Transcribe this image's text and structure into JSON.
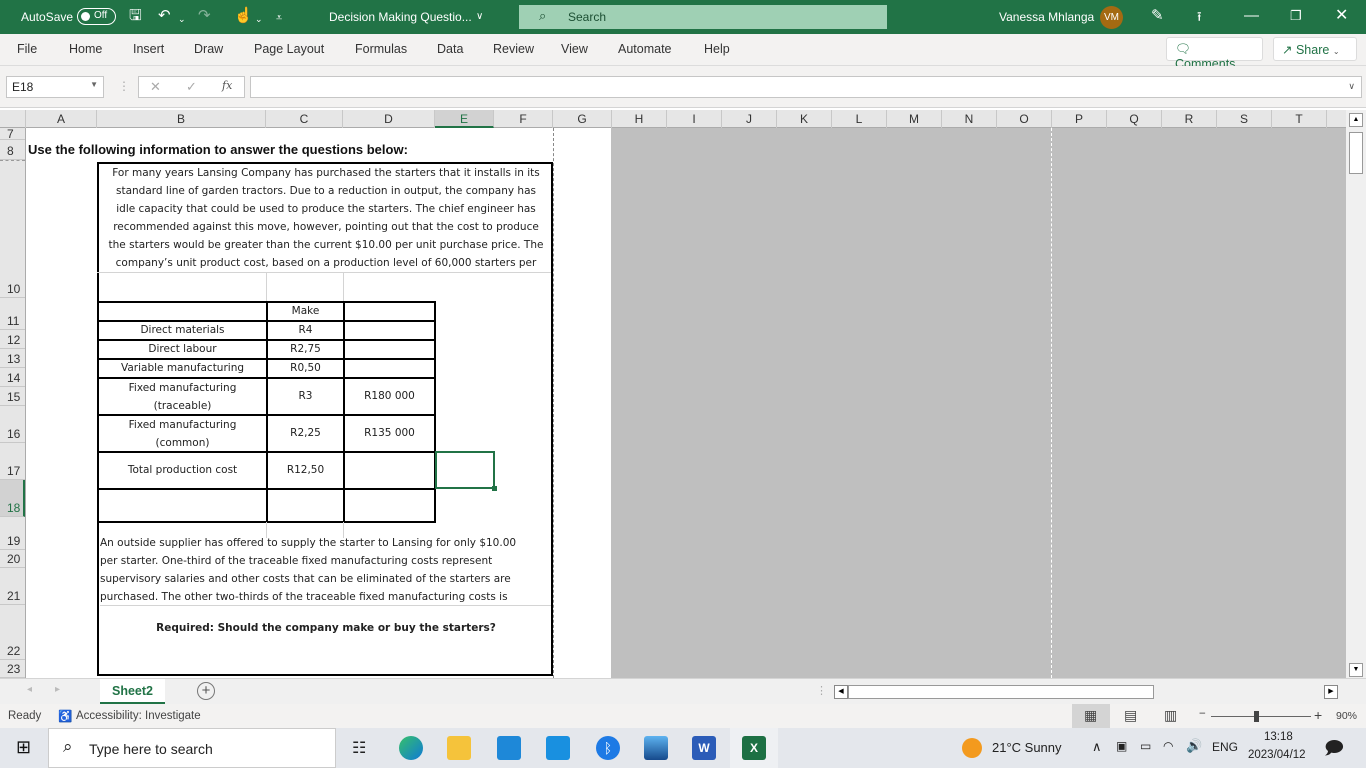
{
  "titlebar": {
    "autosave_label": "AutoSave",
    "autosave_state": "Off",
    "document_title": "Decision Making Questio...",
    "search_placeholder": "Search",
    "user_name": "Vanessa Mhlanga",
    "user_initials": "VM"
  },
  "ribbon": {
    "tabs": [
      "File",
      "Home",
      "Insert",
      "Draw",
      "Page Layout",
      "Formulas",
      "Data",
      "Review",
      "View",
      "Automate",
      "Help"
    ],
    "comments_label": "Comments",
    "share_label": "Share"
  },
  "formula_bar": {
    "name_box": "E18",
    "formula": "",
    "fx_label": "fx"
  },
  "grid": {
    "columns": [
      "A",
      "B",
      "C",
      "D",
      "E",
      "F",
      "G",
      "H",
      "I",
      "J",
      "K",
      "L",
      "M",
      "N",
      "O",
      "P",
      "Q",
      "R",
      "S",
      "T"
    ],
    "selected_column": "E",
    "rows": [
      "7",
      "8",
      "10",
      "11",
      "12",
      "13",
      "14",
      "15",
      "16",
      "17",
      "18",
      "19",
      "20",
      "21",
      "22",
      "23"
    ],
    "selected_row": "18",
    "selected_cell": "E18"
  },
  "sheet": {
    "heading": "Use the following information to answer the questions below:",
    "intro_lines": [
      "For many years Lansing Company has purchased the starters that it installs in its",
      "standard line of garden tractors. Due to a reduction in output, the company has",
      "idle capacity that could be used to produce the starters. The chief engineer has",
      "recommended against this move, however, pointing out that the cost to produce",
      "the starters would be greater than the current $10.00 per unit purchase price. The",
      "company’s unit product cost, based on a production level of 60,000 starters per"
    ],
    "table": {
      "header": [
        "",
        "Make",
        ""
      ],
      "rows": [
        {
          "label": "Direct materials",
          "make": "R4",
          "total": ""
        },
        {
          "label": "Direct labour",
          "make": "R2,75",
          "total": ""
        },
        {
          "label": "Variable manufacturing",
          "make": "R0,50",
          "total": ""
        },
        {
          "label": "Fixed manufacturing (traceable)",
          "label_line1": "Fixed manufacturing",
          "label_line2": "(traceable)",
          "make": "R3",
          "total": "R180 000"
        },
        {
          "label": "Fixed manufacturing (common)",
          "label_line1": "Fixed manufacturing",
          "label_line2": "(common)",
          "make": "R2,25",
          "total": "R135 000"
        },
        {
          "label": "Total production cost",
          "make": "R12,50",
          "total": ""
        },
        {
          "label": "",
          "make": "",
          "total": ""
        }
      ]
    },
    "supplier_lines": [
      "An outside supplier has offered to supply the starter to Lansing for only $10.00",
      "per starter. One-third of the traceable fixed manufacturing costs represent",
      "supervisory salaries and other costs that can be eliminated of the starters are",
      "purchased. The other two-thirds of the traceable fixed manufacturing costs is"
    ],
    "required": "Required: Should the company make or buy the starters?"
  },
  "sheet_tabs": {
    "tabs": [
      "Sheet2"
    ],
    "active": "Sheet2"
  },
  "status_bar": {
    "ready": "Ready",
    "accessibility": "Accessibility: Investigate",
    "zoom": "90%",
    "zoom_fraction": 0.45
  },
  "taskbar": {
    "search_placeholder": "Type here to search",
    "weather": "21°C  Sunny",
    "language": "ENG",
    "time": "13:18",
    "date": "2023/04/12"
  }
}
